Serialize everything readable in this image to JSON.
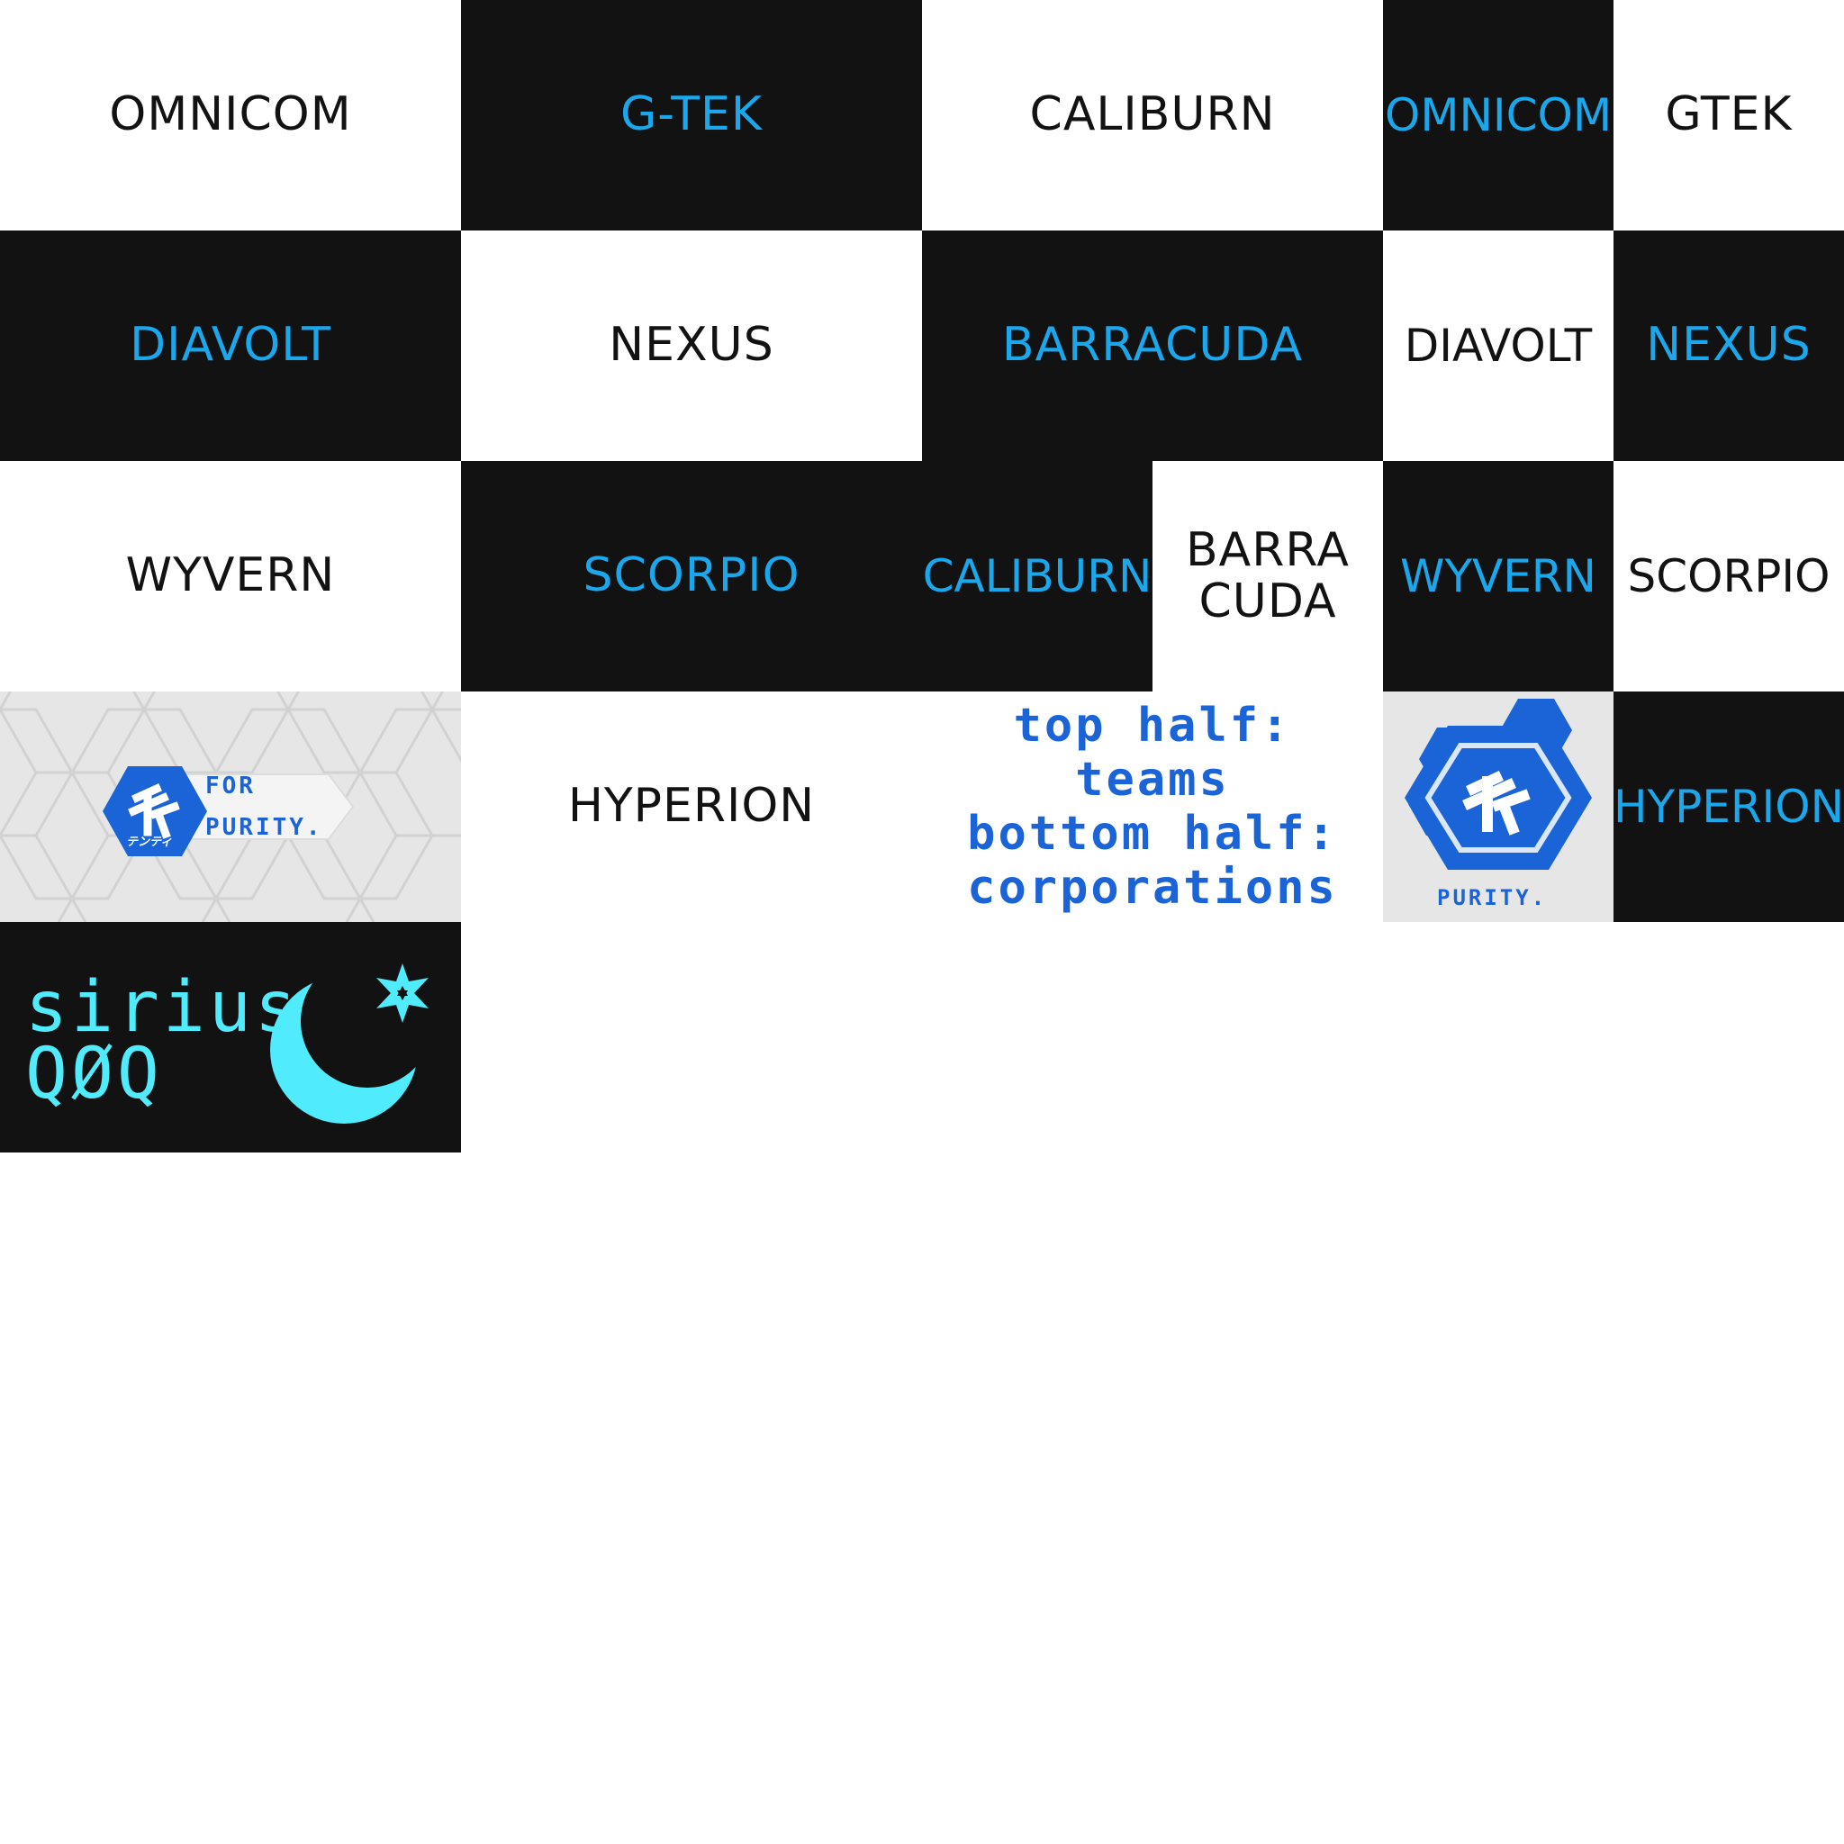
{
  "tiles": {
    "omnicom_white": "OMNICOM",
    "gtek_dark": "G-TEK",
    "caliburn_white": "CALIBURN",
    "omnicom_dark": "OMNICOM",
    "gtek_white": "GTEK",
    "diavolt_dark": "DIAVOLT",
    "nexus_white": "NEXUS",
    "barracuda_dark": "BARRACUDA",
    "diavolt_white": "DIAVOLT",
    "nexus_dark": "NEXUS",
    "wyvern_white": "WYVERN",
    "scorpio_dark": "SCORPIO",
    "caliburn_dark": "CALIBURN",
    "barracuda_white_line1": "BARRA",
    "barracuda_white_line2": "CUDA",
    "wyvern_dark": "WYVERN",
    "scorpio_white": "SCORPIO",
    "hyperion_white": "HYPERION",
    "hyperion_dark": "HYPERION"
  },
  "purity_banner": {
    "line1": "FOR",
    "line2": "PURITY.",
    "katakana": "テンティ"
  },
  "purity_badge": {
    "caption": "PURITY."
  },
  "note": {
    "line1": "top half:",
    "line2": "teams",
    "line3": "bottom half:",
    "line4": "corporations"
  },
  "sirius": {
    "line1": "sirius",
    "line2": "QØQ"
  },
  "colors": {
    "dark_bg": "#121213",
    "accent_blue": "#1aa7ec",
    "purity_blue": "#1a64d8",
    "sirius_cyan": "#50ebfd"
  }
}
